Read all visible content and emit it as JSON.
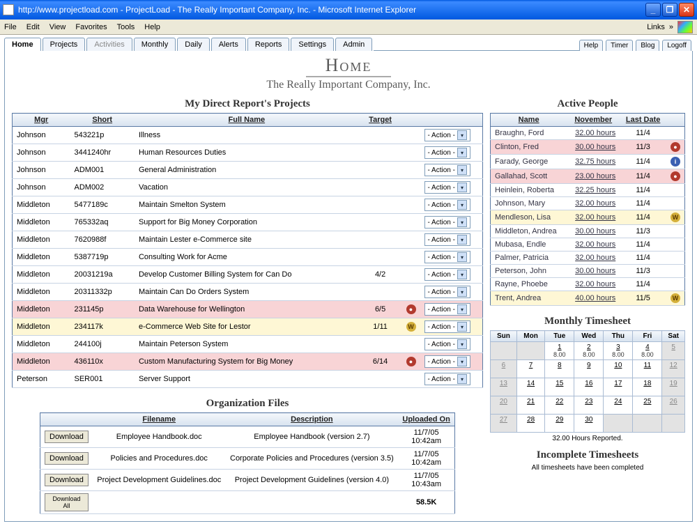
{
  "window": {
    "title": "http://www.projectload.com - ProjectLoad - The Really Important Company, Inc. - Microsoft Internet Explorer",
    "links_label": "Links"
  },
  "menus": [
    "File",
    "Edit",
    "View",
    "Favorites",
    "Tools",
    "Help"
  ],
  "tabs": [
    "Home",
    "Projects",
    "Activities",
    "Monthly",
    "Daily",
    "Alerts",
    "Reports",
    "Settings",
    "Admin"
  ],
  "right_buttons": [
    "Help",
    "Timer",
    "Blog",
    "Logoff"
  ],
  "page": {
    "title": "Home",
    "company": "The Really Important Company, Inc."
  },
  "projects": {
    "title": "My Direct Report's Projects",
    "headers": [
      "Mgr",
      "Short",
      "Full Name",
      "Target"
    ],
    "action_label": "- Action -",
    "rows": [
      {
        "mgr": "Johnson",
        "short": "543221p",
        "full": "Illness",
        "target": "",
        "badge": null,
        "row": ""
      },
      {
        "mgr": "Johnson",
        "short": "3441240hr",
        "full": "Human Resources Duties",
        "target": "",
        "badge": null,
        "row": ""
      },
      {
        "mgr": "Johnson",
        "short": "ADM001",
        "full": "General Administration",
        "target": "",
        "badge": null,
        "row": ""
      },
      {
        "mgr": "Johnson",
        "short": "ADM002",
        "full": "Vacation",
        "target": "",
        "badge": null,
        "row": ""
      },
      {
        "mgr": "Middleton",
        "short": "5477189c",
        "full": "Maintain Smelton System",
        "target": "",
        "badge": null,
        "row": ""
      },
      {
        "mgr": "Middleton",
        "short": "765332aq",
        "full": "Support for Big Money Corporation",
        "target": "",
        "badge": null,
        "row": ""
      },
      {
        "mgr": "Middleton",
        "short": "7620988f",
        "full": "Maintain Lester e-Commerce site",
        "target": "",
        "badge": null,
        "row": ""
      },
      {
        "mgr": "Middleton",
        "short": "5387719p",
        "full": "Consulting Work for Acme",
        "target": "",
        "badge": null,
        "row": ""
      },
      {
        "mgr": "Middleton",
        "short": "20031219a",
        "full": "Develop Customer Billing System for Can Do",
        "target": "4/2",
        "badge": null,
        "row": ""
      },
      {
        "mgr": "Middleton",
        "short": "20311332p",
        "full": "Maintain Can Do Orders System",
        "target": "",
        "badge": null,
        "row": ""
      },
      {
        "mgr": "Middleton",
        "short": "231145p",
        "full": "Data Warehouse for Wellington",
        "target": "6/5",
        "badge": "red",
        "row": "pink"
      },
      {
        "mgr": "Middleton",
        "short": "234117k",
        "full": "e-Commerce Web Site for Lestor",
        "target": "1/11",
        "badge": "gold",
        "row": "yellow"
      },
      {
        "mgr": "Middleton",
        "short": "244100j",
        "full": "Maintain Peterson System",
        "target": "",
        "badge": null,
        "row": ""
      },
      {
        "mgr": "Middleton",
        "short": "436110x",
        "full": "Custom Manufacturing System for Big Money",
        "target": "6/14",
        "badge": "red",
        "row": "pink"
      },
      {
        "mgr": "Peterson",
        "short": "SER001",
        "full": "Server Support",
        "target": "",
        "badge": null,
        "row": ""
      }
    ]
  },
  "people": {
    "title": "Active People",
    "headers": [
      "Name",
      "November",
      "Last Date"
    ],
    "rows": [
      {
        "name": "Braughn, Ford",
        "hours": "32.00 hours",
        "last": "11/4",
        "badge": null,
        "row": ""
      },
      {
        "name": "Clinton, Fred",
        "hours": "30.00 hours",
        "last": "11/3",
        "badge": "red",
        "row": "pink"
      },
      {
        "name": "Farady, George",
        "hours": "32.75 hours",
        "last": "11/4",
        "badge": "blue",
        "row": ""
      },
      {
        "name": "Gallahad, Scott",
        "hours": "23.00 hours",
        "last": "11/4",
        "badge": "red",
        "row": "pink"
      },
      {
        "name": "Heinlein, Roberta",
        "hours": "32.25 hours",
        "last": "11/4",
        "badge": null,
        "row": ""
      },
      {
        "name": "Johnson, Mary",
        "hours": "32.00 hours",
        "last": "11/4",
        "badge": null,
        "row": ""
      },
      {
        "name": "Mendleson, Lisa",
        "hours": "32.00 hours",
        "last": "11/4",
        "badge": "gold",
        "row": "yellow"
      },
      {
        "name": "Middleton, Andrea",
        "hours": "30.00 hours",
        "last": "11/3",
        "badge": null,
        "row": ""
      },
      {
        "name": "Mubasa, Endle",
        "hours": "32.00 hours",
        "last": "11/4",
        "badge": null,
        "row": ""
      },
      {
        "name": "Palmer, Patricia",
        "hours": "32.00 hours",
        "last": "11/4",
        "badge": null,
        "row": ""
      },
      {
        "name": "Peterson, John",
        "hours": "30.00 hours",
        "last": "11/3",
        "badge": null,
        "row": ""
      },
      {
        "name": "Rayne, Phoebe",
        "hours": "32.00 hours",
        "last": "11/4",
        "badge": null,
        "row": ""
      },
      {
        "name": "Trent, Andrea",
        "hours": "40.00 hours",
        "last": "11/5",
        "badge": "gold",
        "row": "yellow"
      }
    ]
  },
  "files": {
    "title": "Organization Files",
    "headers": [
      "",
      "Filename",
      "Description",
      "Uploaded On"
    ],
    "download_label": "Download",
    "download_all_label": "Download All",
    "rows": [
      {
        "filename": "Employee Handbook.doc",
        "description": "Employee Handbook (version 2.7)",
        "uploaded": "11/7/05\n10:42am"
      },
      {
        "filename": "Policies and Procedures.doc",
        "description": "Corporate Policies and Procedures (version 3.5)",
        "uploaded": "11/7/05\n10:42am"
      },
      {
        "filename": "Project Development Guidelines.doc",
        "description": "Project Development Guidelines (version 4.0)",
        "uploaded": "11/7/05\n10:43am"
      }
    ],
    "total_size": "58.5K"
  },
  "timesheet": {
    "title": "Monthly Timesheet",
    "days": [
      "Sun",
      "Mon",
      "Tue",
      "Wed",
      "Thu",
      "Fri",
      "Sat"
    ],
    "weeks": [
      [
        {
          "d": "",
          "gray": true
        },
        {
          "d": "",
          "gray": true
        },
        {
          "d": "1",
          "hrs": "8.00"
        },
        {
          "d": "2",
          "hrs": "8.00"
        },
        {
          "d": "3",
          "hrs": "8.00"
        },
        {
          "d": "4",
          "hrs": "8.00"
        },
        {
          "d": "5",
          "gray": true
        }
      ],
      [
        {
          "d": "6",
          "gray": true
        },
        {
          "d": "7"
        },
        {
          "d": "8"
        },
        {
          "d": "9"
        },
        {
          "d": "10"
        },
        {
          "d": "11"
        },
        {
          "d": "12",
          "gray": true
        }
      ],
      [
        {
          "d": "13",
          "gray": true
        },
        {
          "d": "14"
        },
        {
          "d": "15"
        },
        {
          "d": "16"
        },
        {
          "d": "17"
        },
        {
          "d": "18"
        },
        {
          "d": "19",
          "gray": true
        }
      ],
      [
        {
          "d": "20",
          "gray": true
        },
        {
          "d": "21"
        },
        {
          "d": "22"
        },
        {
          "d": "23"
        },
        {
          "d": "24"
        },
        {
          "d": "25"
        },
        {
          "d": "26",
          "gray": true
        }
      ],
      [
        {
          "d": "27",
          "gray": true
        },
        {
          "d": "28"
        },
        {
          "d": "29"
        },
        {
          "d": "30"
        },
        {
          "d": "",
          "gray": true
        },
        {
          "d": "",
          "gray": true
        },
        {
          "d": "",
          "gray": true
        }
      ]
    ],
    "reported": "32.00 Hours Reported."
  },
  "incomplete": {
    "title": "Incomplete Timesheets",
    "message": "All timesheets have been completed"
  }
}
